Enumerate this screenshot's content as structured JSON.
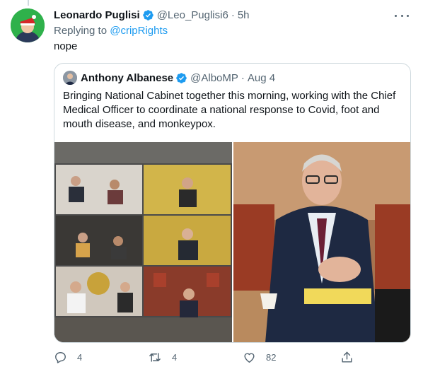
{
  "tweet": {
    "display_name": "Leonardo Puglisi",
    "handle": "@Leo_Puglisi6",
    "separator": "·",
    "time": "5h",
    "replying_prefix": "Replying to",
    "replying_to": "@cripRights",
    "text": "nope"
  },
  "quote": {
    "display_name": "Anthony Albanese",
    "handle": "@AlboMP",
    "separator": "·",
    "date": "Aug 4",
    "text": "Bringing National Cabinet together this morning, working with the Chief Medical Officer to coordinate a national response to Covid, foot and mouth disease, and monkeypox."
  },
  "actions": {
    "reply_count": "4",
    "retweet_count": "4",
    "like_count": "82"
  },
  "colors": {
    "verified": "#1d9bf0",
    "link": "#1d9bf0",
    "muted": "#536471",
    "border": "#cfd9de"
  },
  "icons": {
    "reply": "reply-icon",
    "retweet": "retweet-icon",
    "like": "heart-icon",
    "share": "share-icon",
    "more": "more-icon",
    "verified": "verified-badge-icon"
  }
}
